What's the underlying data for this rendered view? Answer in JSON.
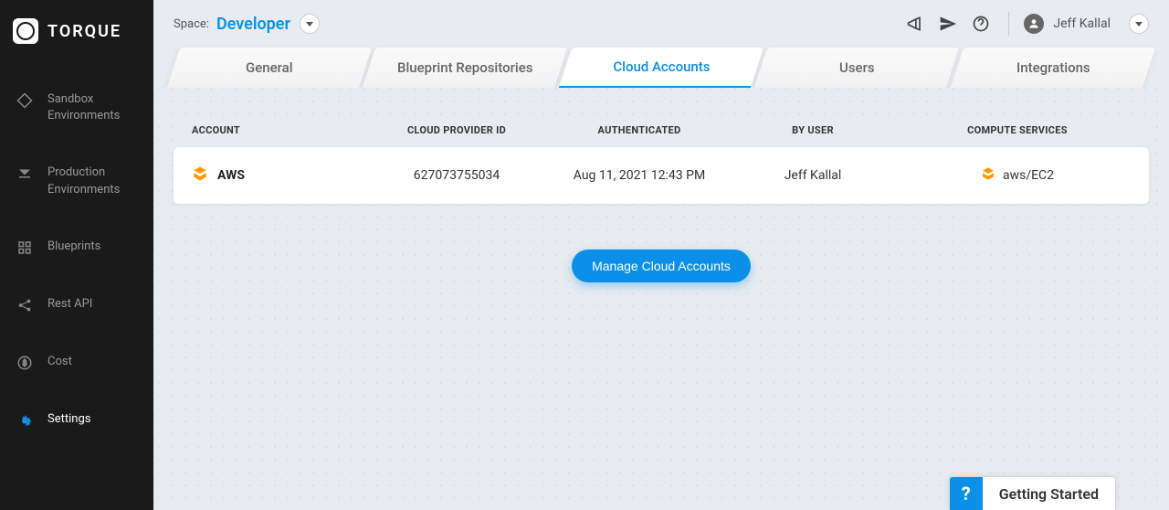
{
  "brand": "TORQUE",
  "header": {
    "space_label": "Space:",
    "space_name": "Developer",
    "user_name": "Jeff Kallal"
  },
  "sidebar": {
    "items": [
      {
        "label": "Sandbox Environments",
        "icon": "diamond-icon"
      },
      {
        "label": "Production Environments",
        "icon": "chevron-double-icon"
      },
      {
        "label": "Blueprints",
        "icon": "grid-icon"
      },
      {
        "label": "Rest API",
        "icon": "share-icon"
      },
      {
        "label": "Cost",
        "icon": "dollar-icon"
      },
      {
        "label": "Settings",
        "icon": "gear-icon",
        "active": true
      }
    ]
  },
  "tabs": [
    {
      "label": "General"
    },
    {
      "label": "Blueprint Repositories"
    },
    {
      "label": "Cloud Accounts",
      "active": true
    },
    {
      "label": "Users"
    },
    {
      "label": "Integrations"
    }
  ],
  "table": {
    "headers": {
      "account": "ACCOUNT",
      "provider": "CLOUD PROVIDER ID",
      "auth": "AUTHENTICATED",
      "user": "BY USER",
      "services": "COMPUTE SERVICES"
    },
    "rows": [
      {
        "account": "AWS",
        "provider_id": "627073755034",
        "authenticated": "Aug 11, 2021 12:43 PM",
        "by_user": "Jeff Kallal",
        "compute_services": "aws/EC2"
      }
    ]
  },
  "buttons": {
    "manage": "Manage Cloud Accounts"
  },
  "getting_started": {
    "label": "Getting Started",
    "question": "?"
  }
}
